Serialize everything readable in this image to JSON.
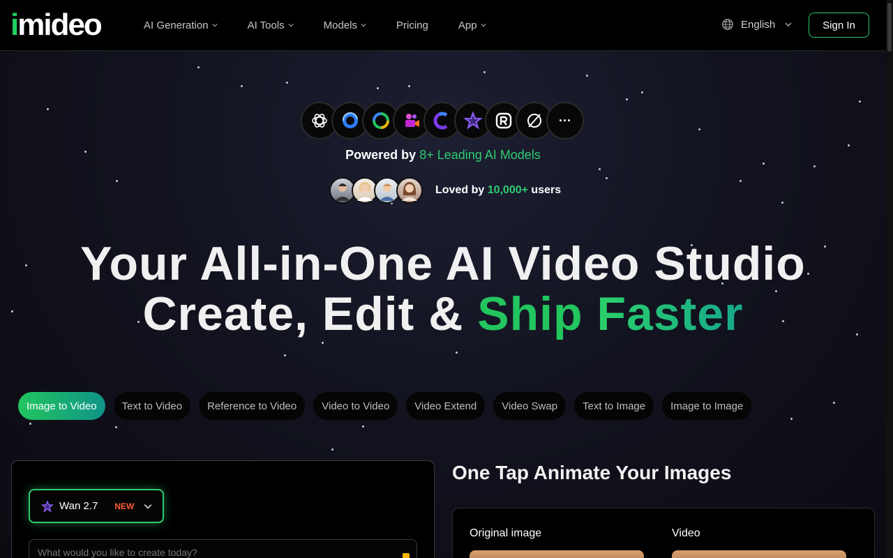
{
  "header": {
    "logo": "imideo",
    "logo_i": "i",
    "logo_rest": "mideo",
    "nav": [
      {
        "label": "AI Generation",
        "dropdown": true
      },
      {
        "label": "AI Tools",
        "dropdown": true
      },
      {
        "label": "Models",
        "dropdown": true
      },
      {
        "label": "Pricing",
        "dropdown": false
      },
      {
        "label": "App",
        "dropdown": true
      }
    ],
    "language": "English",
    "sign_in": "Sign In"
  },
  "models": {
    "icons": [
      "openai-icon",
      "model-swirl-icon",
      "model-ring-icon",
      "video-camera-icon",
      "model-c-icon",
      "star-model-icon",
      "r-logo-icon",
      "slash-circle-icon",
      "more-icon"
    ],
    "more_label": "···",
    "powered_prefix": "Powered by ",
    "powered_highlight": "8+ Leading AI Models"
  },
  "users": {
    "avatars": 4,
    "loved_prefix": "Loved by ",
    "loved_highlight": "10,000+",
    "loved_suffix": " users"
  },
  "hero": {
    "line1": "Your All-in-One AI Video Studio",
    "line2_prefix": "Create, Edit & ",
    "line2_ship": "Ship ",
    "line2_faster": "Faster"
  },
  "tabs": [
    {
      "label": "Image to Video",
      "active": true
    },
    {
      "label": "Text to Video",
      "active": false
    },
    {
      "label": "Reference to Video",
      "active": false
    },
    {
      "label": "Video to Video",
      "active": false
    },
    {
      "label": "Video Extend",
      "active": false
    },
    {
      "label": "Video Swap",
      "active": false
    },
    {
      "label": "Text to Image",
      "active": false
    },
    {
      "label": "Image to Image",
      "active": false
    }
  ],
  "generator": {
    "model_name": "Wan 2.7",
    "model_badge": "NEW",
    "prompt_placeholder": "What would you like to create today?"
  },
  "showcase": {
    "title": "One Tap Animate Your Images",
    "original_label": "Original image",
    "video_label": "Video"
  },
  "colors": {
    "accent": "#2ecc71",
    "badge": "#ff5a36"
  }
}
